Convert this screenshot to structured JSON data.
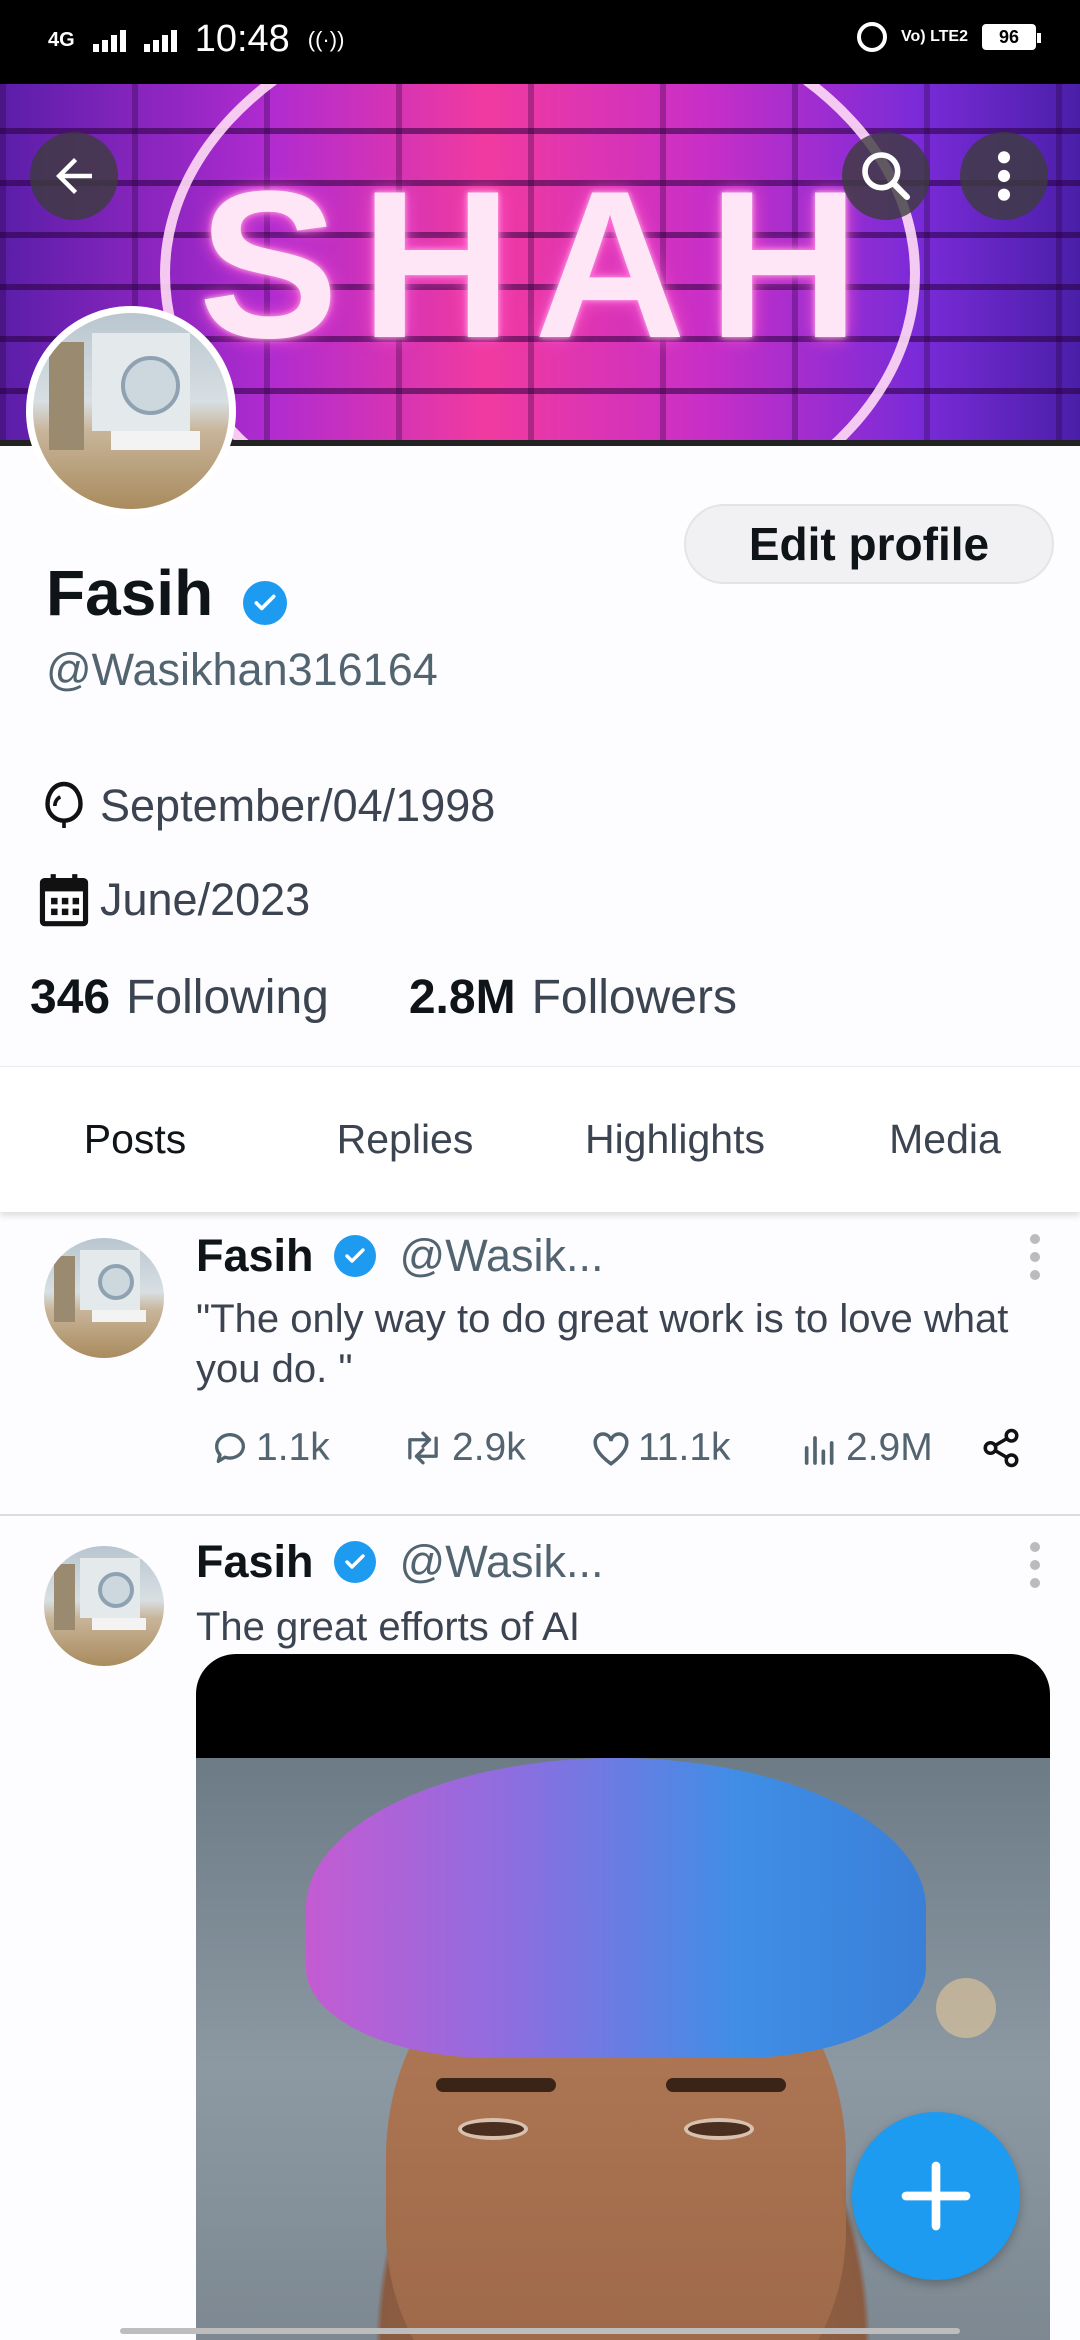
{
  "status_bar": {
    "network": "4G",
    "time": "10:48",
    "volte": "Vo) LTE2",
    "battery": "96"
  },
  "banner": {
    "text": "SHAH"
  },
  "profile": {
    "name": "Fasih",
    "handle": "@Wasikhan316164",
    "edit_label": "Edit profile",
    "birthday": "September/04/1998",
    "joined": "June/2023",
    "following_count": "346",
    "following_label": "Following",
    "followers_count": "2.8M",
    "followers_label": "Followers"
  },
  "tabs": [
    {
      "label": "Posts",
      "active": true
    },
    {
      "label": "Replies",
      "active": false
    },
    {
      "label": "Highlights",
      "active": false
    },
    {
      "label": "Media",
      "active": false
    }
  ],
  "posts": [
    {
      "name": "Fasih",
      "handle": "@Wasik...",
      "text": "\"The only way to do great work is to love what you do. \"",
      "replies": "1.1k",
      "reposts": "2.9k",
      "likes": "11.1k",
      "views": "2.9M"
    },
    {
      "name": "Fasih",
      "handle": "@Wasik...",
      "text": "The great efforts of AI"
    }
  ],
  "colors": {
    "accent": "#1d9bf0",
    "text": "#0f1419",
    "secondary": "#536471"
  },
  "icons": [
    "back-arrow-icon",
    "search-icon",
    "more-vert-icon",
    "verified-badge-icon",
    "balloon-icon",
    "calendar-icon",
    "reply-icon",
    "repost-icon",
    "like-icon",
    "views-icon",
    "share-icon",
    "plus-icon"
  ]
}
